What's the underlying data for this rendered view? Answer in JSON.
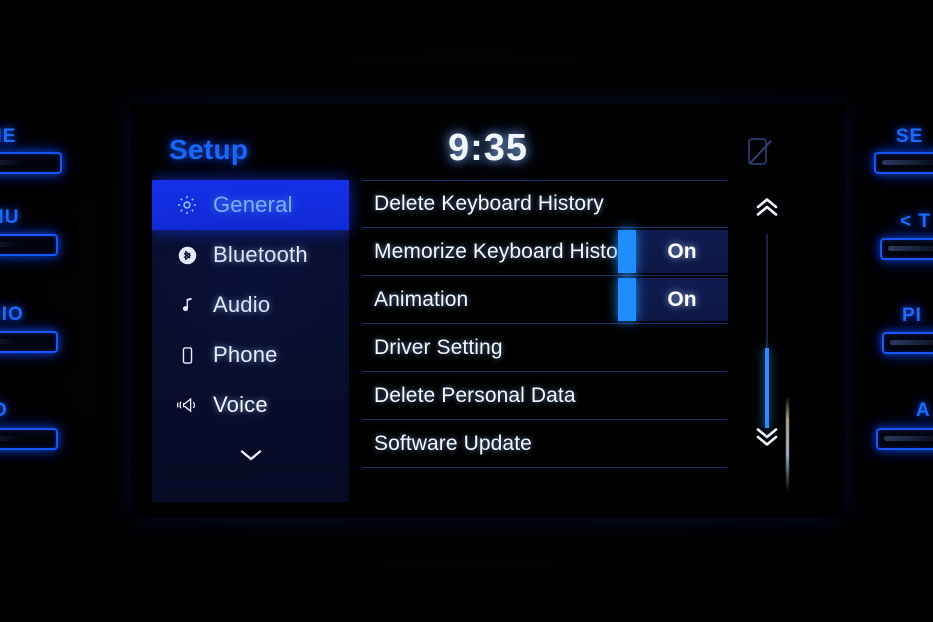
{
  "header": {
    "title": "Setup",
    "clock": "9:35",
    "status_icon": "phone-disconnected-icon"
  },
  "sidebar": {
    "items": [
      {
        "label": "General",
        "icon": "gear-icon",
        "selected": true
      },
      {
        "label": "Bluetooth",
        "icon": "bluetooth-icon",
        "selected": false
      },
      {
        "label": "Audio",
        "icon": "music-note-icon",
        "selected": false
      },
      {
        "label": "Phone",
        "icon": "phone-icon",
        "selected": false
      },
      {
        "label": "Voice",
        "icon": "voice-icon",
        "selected": false
      }
    ],
    "more_icon": "chevron-down-icon"
  },
  "list": {
    "rows": [
      {
        "label": "Delete Keyboard History",
        "toggle": null
      },
      {
        "label": "Memorize Keyboard History",
        "toggle": "On"
      },
      {
        "label": "Animation",
        "toggle": "On"
      },
      {
        "label": "Driver Setting",
        "toggle": null
      },
      {
        "label": "Delete Personal Data",
        "toggle": null
      },
      {
        "label": "Software Update",
        "toggle": null
      }
    ]
  },
  "scrollbar": {
    "up_icon": "double-chevron-up-icon",
    "down_icon": "double-chevron-down-icon",
    "thumb_position_percent": 61
  },
  "hardware_buttons": {
    "left": [
      {
        "label": "NE"
      },
      {
        "label": "NU"
      },
      {
        "label": "DIO"
      },
      {
        "label": "O"
      }
    ],
    "right": [
      {
        "label": "SE"
      },
      {
        "label": "< T"
      },
      {
        "label": "PI"
      },
      {
        "label": "A"
      }
    ]
  },
  "colors": {
    "accent_blue": "#1668ff",
    "highlight_blue": "#1430e8",
    "toggle_blue": "#1f8cff",
    "panel_navy": "#0a0f33",
    "separator": "#12306e",
    "text_white": "#f3f7ff"
  }
}
